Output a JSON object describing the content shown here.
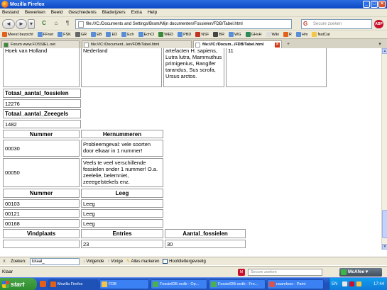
{
  "window": {
    "title": "Mozilla Firefox",
    "buttons": [
      "_",
      "□",
      "×"
    ]
  },
  "menu": [
    "Bestand",
    "Bewerken",
    "Beeld",
    "Geschiedenis",
    "Bladwijzers",
    "Extra",
    "Help"
  ],
  "nav": {
    "back": "◄",
    "forward": "►",
    "dropdown": "▾",
    "reload": "C",
    "home": "⌂",
    "extra": "¶",
    "url": "file:///C:/Documents and Settings/Bram/Mijn documenten/Fossielen/FDB/Tabel.html",
    "search_placeholder": "Secure zoeken",
    "abp": "ABP"
  },
  "bookmarks": [
    "Meest bezocht",
    "FFnet",
    "FSK",
    "GR",
    "EB",
    "ED",
    "Ech",
    "EchCl",
    "WED",
    "PBD",
    "NSF",
    "BR",
    "WG",
    "GHvH",
    "Wiki",
    "R",
    "Hm",
    "NatCat"
  ],
  "tabs": [
    {
      "label": "Forum www.FOSSIEL.net",
      "active": false
    },
    {
      "label": "file:///C:/Document...len/FDB/Tabel.html",
      "active": false
    },
    {
      "label": "file:///C:/Docum.../FDB/Tabel.html",
      "active": true
    }
  ],
  "table_top": {
    "location": "Hoek van Holland",
    "country": "Nederland",
    "fossils": "artefacten H. sapiens, Lutra lutra, Mammuthus primigenius, Rangifer tarandus, Sus scrofa, Ursus arctos.",
    "count": "11"
  },
  "totals": {
    "fossils_label": "Totaal_aantal_fossielen",
    "fossils_value": "12276",
    "seeurchins_label": "Totaal_aantal_Zeeegels",
    "seeurchins_value": "1482"
  },
  "renumber_table": {
    "headers": [
      "Nummer",
      "Hernummeren"
    ],
    "rows": [
      [
        "00030",
        "Probleemgeval: vele soorten door elkaar in 1 nummer!"
      ],
      [
        "00050",
        "Veels te veel verschillende fossielen onder 1 nummer! O.a. zeelelie, belemniet, zeeegelstekels enz."
      ]
    ]
  },
  "empty_table": {
    "headers": [
      "Nummer",
      "Leeg"
    ],
    "rows": [
      [
        "00103",
        "Leeg"
      ],
      [
        "00121",
        "Leeg"
      ],
      [
        "00168",
        "Leeg"
      ]
    ]
  },
  "location_table": {
    "headers": [
      "Vindplaats",
      "Entries",
      "Aantal_fossielen"
    ],
    "rows": [
      [
        "",
        "23",
        "30"
      ]
    ]
  },
  "findbar": {
    "close": "x",
    "label": "Zoeken:",
    "value": "totaal_",
    "next": "Volgende",
    "prev": "Vorige",
    "highlight": "Alles markeren",
    "matchcase": "Hoofdlettergevoelig"
  },
  "status": {
    "text": "Klaar",
    "secure_search": "Secure zoeken",
    "mcafee": "McAfee"
  },
  "taskbar": {
    "start": "start",
    "buttons": [
      {
        "label": "Mozilla Firefox",
        "active": true,
        "color": "#e2601a"
      },
      {
        "label": "FDB",
        "active": false,
        "color": "#f3c64a"
      },
      {
        "label": "FossielDB.ocdb - Op...",
        "active": false,
        "color": "#4caf50"
      },
      {
        "label": "FossielDB.ocdb - Fro...",
        "active": false,
        "color": "#4caf50"
      },
      {
        "label": "naamloos - Paint",
        "active": false,
        "color": "#d9534f"
      }
    ],
    "lang": "EN",
    "clock": "17:44"
  }
}
